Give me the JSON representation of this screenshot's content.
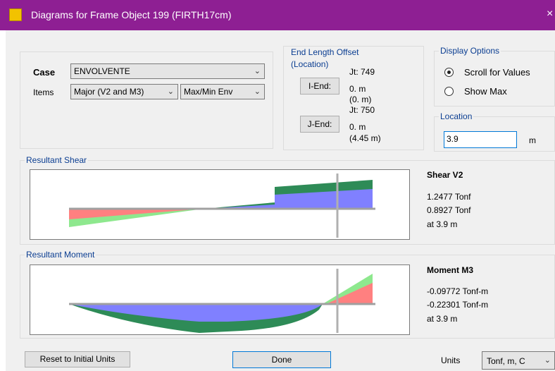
{
  "window": {
    "title": "Diagrams for Frame Object 199  (FIRTH17cm)",
    "close_glyph": "×"
  },
  "case_panel": {
    "case_label": "Case",
    "case_value": "ENVOLVENTE",
    "items_label": "Items",
    "items_value": "Major (V2 and M3)",
    "env_value": "Max/Min Env"
  },
  "end_offset": {
    "title": "End Length Offset (Location)",
    "i_end_button": "I-End:",
    "i_jt": "Jt:  749",
    "i_offset": "0. m",
    "i_location": "(0. m)",
    "j_end_button": "J-End:",
    "j_jt": "Jt:  750",
    "j_offset": "0. m",
    "j_location": "(4.45 m)"
  },
  "display_options": {
    "title": "Display Options",
    "scroll": "Scroll for Values",
    "show_max": "Show Max",
    "selected": "scroll"
  },
  "location": {
    "title": "Location",
    "value": "3.9",
    "unit": "m"
  },
  "shear": {
    "group_title": "Resultant Shear",
    "heading": "Shear V2",
    "max": "1.2477 Tonf",
    "min": "0.8927 Tonf",
    "at": "at 3.9 m"
  },
  "moment": {
    "group_title": "Resultant Moment",
    "heading": "Moment M3",
    "max": "-0.09772 Tonf-m",
    "min": "-0.22301 Tonf-m",
    "at": "at 3.9 m"
  },
  "footer": {
    "reset": "Reset to Initial Units",
    "done": "Done",
    "units_label": "Units",
    "units_value": "Tonf, m, C"
  },
  "colors": {
    "title_bar": "#8e1f93",
    "green_env": "#2e8b57",
    "light_green": "#8ee88e",
    "blue_fill": "#8080ff",
    "red_fill": "#ff8080",
    "cursor": "#b0b0b0"
  },
  "icons": [
    "app-icon",
    "close-icon",
    "chevron-down-icon"
  ]
}
